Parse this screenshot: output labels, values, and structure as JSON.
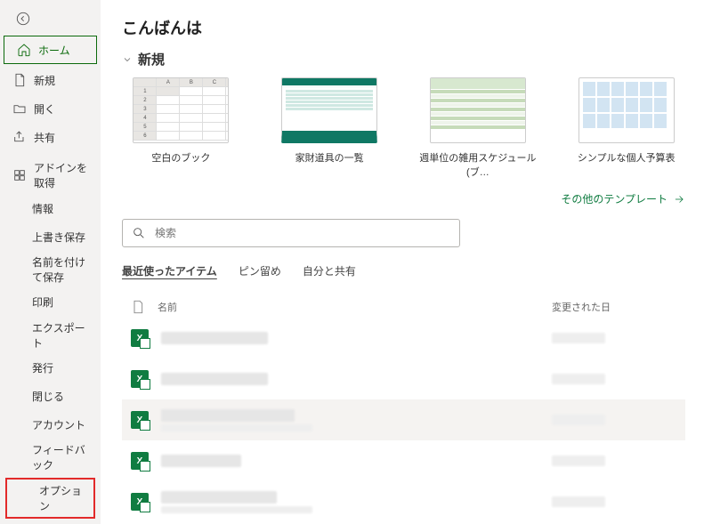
{
  "sidebar": {
    "home": "ホーム",
    "new": "新規",
    "open": "開く",
    "share": "共有",
    "getaddins": "アドインを取得",
    "info": "情報",
    "save": "上書き保存",
    "saveas": "名前を付けて保存",
    "print": "印刷",
    "export": "エクスポート",
    "publish": "発行",
    "close": "閉じる",
    "account": "アカウント",
    "feedback": "フィードバック",
    "options": "オプション"
  },
  "main": {
    "greeting": "こんばんは",
    "new_section": "新規",
    "templates": [
      {
        "label": "空白のブック"
      },
      {
        "label": "家財道具の一覧"
      },
      {
        "label": "週単位の雑用スケジュール (ブ…"
      },
      {
        "label": "シンプルな個人予算表"
      }
    ],
    "more_templates": "その他のテンプレート",
    "search_placeholder": "検索",
    "tabs": {
      "recent": "最近使ったアイテム",
      "pinned": "ピン留め",
      "shared": "自分と共有"
    },
    "list_header": {
      "name": "名前",
      "date": "変更された日"
    }
  }
}
